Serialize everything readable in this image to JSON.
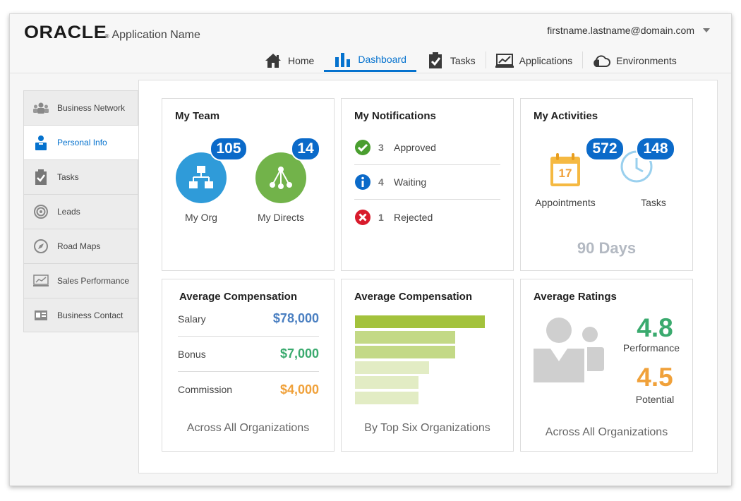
{
  "header": {
    "logo_text": "ORACLE",
    "app_name": "Application Name",
    "user_email": "firstname.lastname@domain.com"
  },
  "topnav": [
    {
      "label": "Home",
      "icon": "home-icon",
      "active": false
    },
    {
      "label": "Dashboard",
      "icon": "bar-chart-icon",
      "active": true
    },
    {
      "label": "Tasks",
      "icon": "clipboard-check-icon",
      "active": false
    },
    {
      "label": "Applications",
      "icon": "monitor-chart-icon",
      "active": false
    },
    {
      "label": "Environments",
      "icon": "cloud-icon",
      "active": false
    }
  ],
  "sidebar": [
    {
      "label": "Business Network",
      "icon": "people-group-icon"
    },
    {
      "label": "Personal Info",
      "icon": "person-badge-icon",
      "active": true
    },
    {
      "label": "Tasks",
      "icon": "clipboard-check-icon"
    },
    {
      "label": "Leads",
      "icon": "target-icon"
    },
    {
      "label": "Road Maps",
      "icon": "compass-icon"
    },
    {
      "label": "Sales Performance",
      "icon": "line-chart-icon"
    },
    {
      "label": "Business Contact",
      "icon": "contact-card-icon"
    }
  ],
  "team": {
    "title": "My Team",
    "org": {
      "count": "105",
      "label": "My Org"
    },
    "directs": {
      "count": "14",
      "label": "My Directs"
    }
  },
  "notifications": {
    "title": "My Notifications",
    "items": [
      {
        "count": "3",
        "label": "Approved",
        "icon": "check-circle-icon"
      },
      {
        "count": "4",
        "label": "Waiting",
        "icon": "info-circle-icon"
      },
      {
        "count": "1",
        "label": "Rejected",
        "icon": "error-circle-icon"
      }
    ]
  },
  "activities": {
    "title": "My Activities",
    "appointments": {
      "count": "572",
      "label": "Appointments",
      "calendar_day": "17"
    },
    "tasks": {
      "count": "148",
      "label": "Tasks"
    },
    "period": "90 Days"
  },
  "compensation": {
    "title": "Average Compensation",
    "rows": [
      {
        "label": "Salary",
        "value": "$78,000",
        "color": "#4a7fc1"
      },
      {
        "label": "Bonus",
        "value": "$7,000",
        "color": "#3aaa6e"
      },
      {
        "label": "Commission",
        "value": "$4,000",
        "color": "#f0a13a"
      }
    ],
    "footer": "Across All Organizations"
  },
  "compensation_chart": {
    "title": "Average Compensation",
    "footer": "By Top Six Organizations"
  },
  "chart_data": {
    "type": "bar",
    "orientation": "horizontal",
    "title": "Average Compensation",
    "categories": [
      "",
      "",
      "",
      "",
      "",
      ""
    ],
    "values": [
      100,
      77,
      77,
      57,
      49,
      49
    ],
    "colors": [
      "#a3c23c",
      "#c3d986",
      "#c3d986",
      "#e2ecc4",
      "#e2ecc4",
      "#e2ecc4"
    ],
    "xlabel": "",
    "ylabel": "",
    "grid": false
  },
  "ratings": {
    "title": "Average Ratings",
    "performance": {
      "value": "4.8",
      "label": "Performance",
      "color": "#3aaa6e"
    },
    "potential": {
      "value": "4.5",
      "label": "Potential",
      "color": "#f0a13a"
    },
    "footer": "Across All Organizations"
  }
}
